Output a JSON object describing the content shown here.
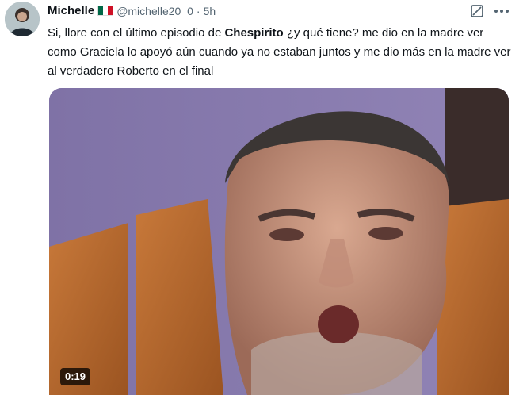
{
  "author": {
    "display_name": "Michelle",
    "handle": "@michelle20_0",
    "separator": "·",
    "time": "5h"
  },
  "icons": {
    "grok": "grok-icon",
    "more": "more-options-icon",
    "flag": "mexico-flag-icon"
  },
  "tweet": {
    "part1": "Si, llore con el último episodio de ",
    "bold": "Chespirito",
    "part2": " ¿y qué tiene? me dio en la madre ver como Graciela lo apoyó aún cuando ya no estaban juntos y me dio más en la madre ver al verdadero Roberto en el final"
  },
  "media": {
    "duration": "0:19"
  },
  "colors": {
    "text": "#0f1419",
    "muted": "#536471",
    "badge_bg": "#000000"
  }
}
